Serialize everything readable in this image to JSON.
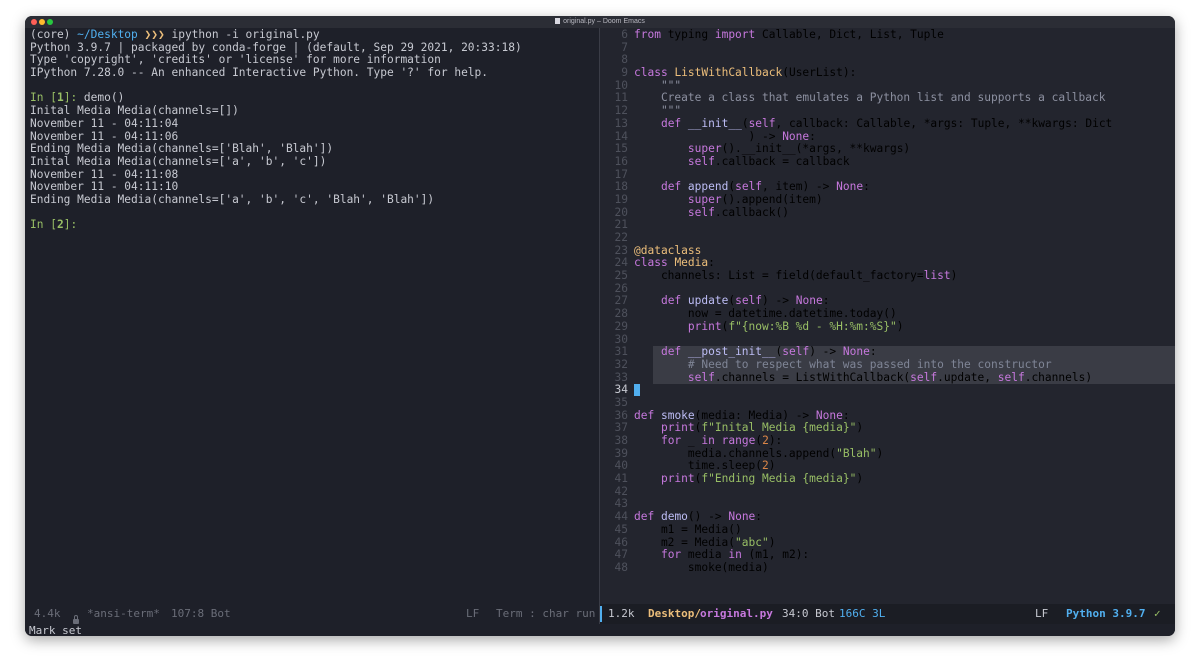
{
  "window": {
    "title": "original.py – Doom Emacs"
  },
  "terminal": {
    "prompt_user": "(core) ",
    "prompt_path": "~/Desktop",
    "prompt_arrows": " ❯❯❯ ",
    "prompt_command": "ipython -i original.py",
    "lines": [
      "Python 3.9.7 | packaged by conda-forge | (default, Sep 29 2021, 20:33:18)",
      "Type 'copyright', 'credits' or 'license' for more information",
      "IPython 7.28.0 -- An enhanced Interactive Python. Type '?' for help.",
      "",
      "",
      "Inital Media Media(channels=[])",
      "November 11 - 04:11:04",
      "November 11 - 04:11:06",
      "Ending Media Media(channels=['Blah', 'Blah'])",
      "Inital Media Media(channels=['a', 'b', 'c'])",
      "November 11 - 04:11:08",
      "November 11 - 04:11:10",
      "Ending Media Media(channels=['a', 'b', 'c', 'Blah', 'Blah'])",
      ""
    ],
    "in1_label": "In [",
    "in1_num": "1",
    "in1_close": "]: ",
    "in1_cmd": "demo()",
    "in2_label": "In [",
    "in2_num": "2",
    "in2_close": "]: "
  },
  "editor": {
    "line_numbers": [
      "6",
      "7",
      "8",
      "9",
      "10",
      "11",
      "12",
      "13",
      "14",
      "15",
      "16",
      "17",
      "18",
      "19",
      "20",
      "21",
      "22",
      "23",
      "24",
      "25",
      "26",
      "27",
      "28",
      "29",
      "30",
      "31",
      "32",
      "33",
      "34",
      "35",
      "36",
      "37",
      "38",
      "39",
      "40",
      "41",
      "42",
      "43",
      "44",
      "45",
      "46",
      "47",
      "48"
    ]
  },
  "modeline_left": {
    "size": "4.4k",
    "buffer": "*ansi-term*",
    "position": "107:8 Bot",
    "eol": "LF",
    "mode": "Term : char run"
  },
  "modeline_right": {
    "size": "1.2k",
    "dir": "Desktop/",
    "file": "original.py",
    "position": "34:0 Bot",
    "chars": "166C 3L",
    "eol": "LF",
    "python": "Python 3.9.7",
    "check": "✓"
  },
  "minibuffer": {
    "message": "Mark set"
  },
  "colors": {
    "accent": "#51afef",
    "string": "#98be65",
    "keyword": "#c678dd",
    "class": "#ecbe7b"
  },
  "icons": {
    "modeline_check": "check-icon",
    "modeline_lock": "lock-icon"
  }
}
